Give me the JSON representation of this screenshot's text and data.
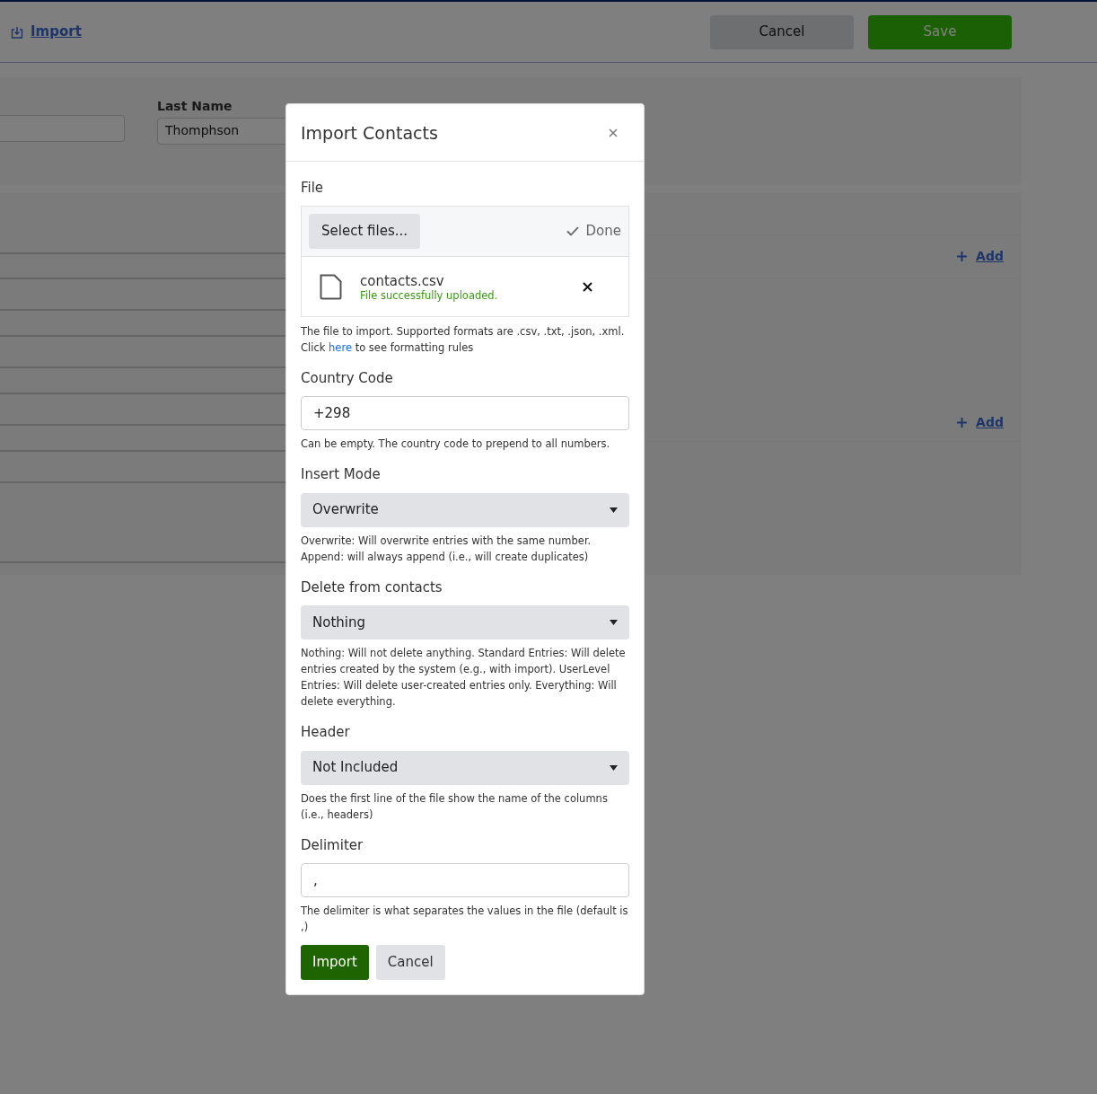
{
  "header": {
    "title": "Import",
    "buttons": [
      {
        "label": "Cancel",
        "kind": "secondary"
      },
      {
        "label": "Save",
        "kind": "primary"
      }
    ]
  },
  "contact_form": {
    "fields": [
      {
        "kind": "unlabeled"
      },
      {
        "kind": "labeled",
        "label": "Last Name",
        "value": "Thomphson"
      }
    ]
  },
  "sections": [
    {
      "add_label": "Add"
    },
    {
      "add_label": "Add"
    }
  ],
  "modal": {
    "title": "Import Contacts",
    "file": {
      "label": "File",
      "select_button": "Select files...",
      "status": "Done",
      "uploaded": {
        "name": "contacts.csv",
        "message": "File successfully uploaded."
      },
      "help_before": "The file to import. Supported formats are .csv, .txt, .json, .xml. Click",
      "help_link": "here",
      "help_after": "to see formatting rules"
    },
    "fields": [
      {
        "kind": "text",
        "label": "Country Code",
        "value": "+298",
        "help": "Can be empty. The country code to prepend to all numbers."
      },
      {
        "kind": "select",
        "label": "Insert Mode",
        "value": "Overwrite",
        "help": "Overwrite: Will overwrite entries with the same number. Append: will always append (i.e., will create duplicates)"
      },
      {
        "kind": "select",
        "label": "Delete from contacts",
        "value": "Nothing",
        "help": "Nothing: Will not delete anything. Standard Entries: Will delete entries created by the system (e.g., with import). UserLevel Entries: Will delete user-created entries only. Everything: Will delete everything."
      },
      {
        "kind": "select",
        "label": "Header",
        "value": "Not Included",
        "help": "Does the first line of the file show the name of the columns (i.e., headers)"
      },
      {
        "kind": "text",
        "label": "Delimiter",
        "value": ",",
        "help": "The delimiter is what separates the values in the file (default is ,)"
      }
    ],
    "buttons": [
      {
        "label": "Import",
        "kind": "primary"
      },
      {
        "label": "Cancel",
        "kind": "secondary"
      }
    ]
  }
}
